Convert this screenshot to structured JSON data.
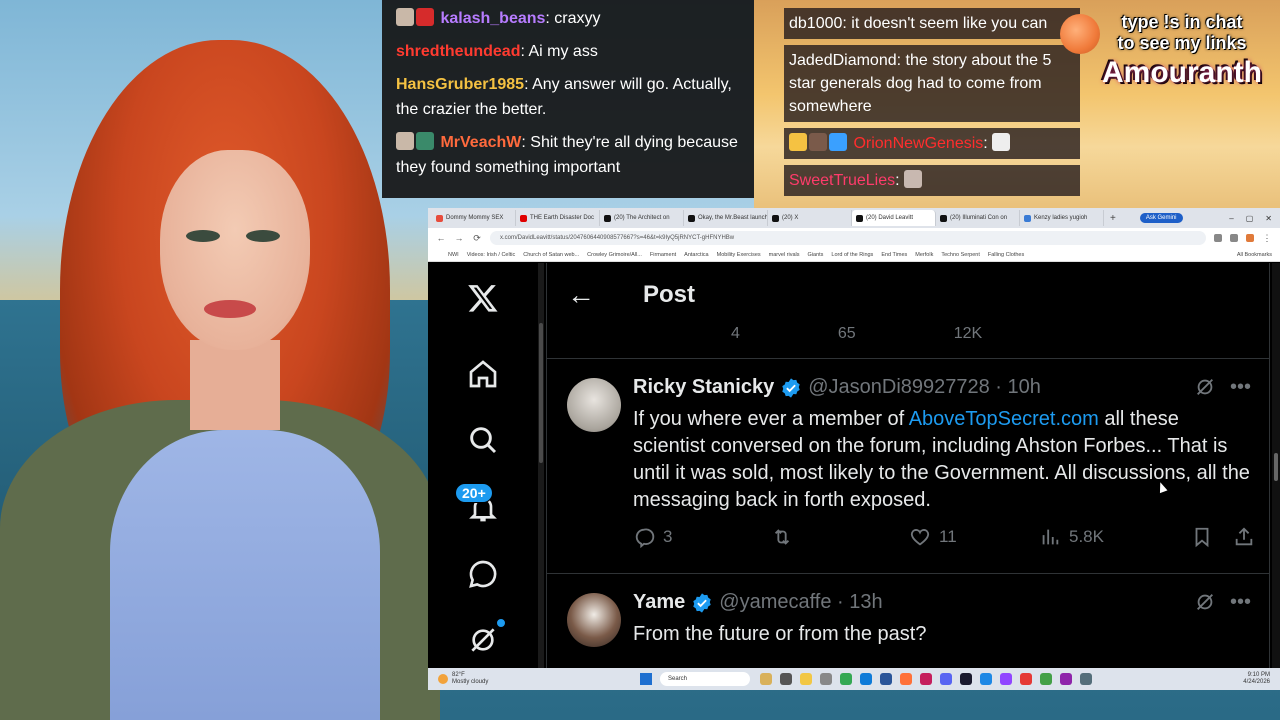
{
  "chat_left": [
    {
      "user": "kalash_beans",
      "color": "#b77cff",
      "text": ": craxyy",
      "emotes": [
        "skull",
        "umbrella"
      ]
    },
    {
      "user": "shredtheundead",
      "color": "#ff3b30",
      "text": ": Ai my ass",
      "emotes": []
    },
    {
      "user": "HansGruber1985",
      "color": "#f5c242",
      "text": ": Any answer will go. Actually, the crazier the better.",
      "emotes": []
    },
    {
      "user": "MrVeachW",
      "color": "#ff6a3d",
      "text": ": Shit they're all dying because they found something important",
      "emotes": [
        "skull",
        "fish"
      ]
    }
  ],
  "chat_right": [
    {
      "user": "db1000",
      "color": "#ffffff",
      "text": ": it doesn't seem like you can"
    },
    {
      "user": "JadedDiamond",
      "color": "#ffffff",
      "text": ": the story about the 5 star generals dog had to come from somewhere"
    },
    {
      "user": "OrionNewGenesis",
      "color": "#ff2d2d",
      "text": ": "
    },
    {
      "user": "SweetTrueLies",
      "color": "#ff3b6b",
      "text": ": "
    }
  ],
  "promo": {
    "line1": "type !s in chat",
    "line2": "to see my links",
    "name": "Amouranth"
  },
  "browser": {
    "tabs": [
      {
        "label": "Dommy Mommy SEX",
        "color": "#e74c3c",
        "active": false
      },
      {
        "label": "THE Earth Disaster Doc",
        "color": "#e00000",
        "active": false
      },
      {
        "label": "(20) The Architect on",
        "color": "#111111",
        "active": false
      },
      {
        "label": "Okay, the Mr.Beast launch",
        "color": "#111111",
        "active": false
      },
      {
        "label": "(20) X",
        "color": "#111111",
        "active": false
      },
      {
        "label": "(20) David Leavitt",
        "color": "#111111",
        "active": true
      },
      {
        "label": "(20) Illuminati Con on",
        "color": "#111111",
        "active": false
      },
      {
        "label": "Kenzy ladies yugioh",
        "color": "#3a7bd5",
        "active": false
      }
    ],
    "new_tab": "+",
    "ask_gemini": "Ask Gemini",
    "url": "x.com/DavidLeavitt/status/2047606440908577667?s=46&t=k9IyQ5jRNYCT-gHFNYHBw",
    "bookmarks": [
      "NWI",
      "Videos: Irish / Celtic",
      "Church of Satan web...",
      "Crowley Grimoire/All...",
      "Firmament",
      "Antarctica",
      "Mobility Exercises",
      "marvel rivals",
      "Giants",
      "Lord of the Rings",
      "End Times",
      "Merfolk",
      "Techno Serpent",
      "Falling Clothes"
    ],
    "all_bookmarks": "All Bookmarks"
  },
  "x": {
    "page_title": "Post",
    "prev_actions": [
      "",
      "4",
      "65",
      "12K"
    ],
    "notifications_badge": "20+",
    "tweets": [
      {
        "name": "Ricky Stanicky",
        "handle": "@JasonDi89927728 · 10h",
        "body_before": "If you where ever a member of ",
        "link": "AboveTopSecret.com",
        "body_after": " all these scientist conversed on the forum, including Ahston Forbes... That is until it was sold, most likely to the Government.  All discussions, all the messaging back in forth exposed.",
        "replies": "3",
        "reposts": "",
        "likes": "11",
        "views": "5.8K"
      },
      {
        "name": "Yame",
        "handle": "@yamecaffe · 13h",
        "body": "From the future or from the past?"
      }
    ]
  },
  "taskbar": {
    "weather_temp": "82°F",
    "weather_desc": "Mostly cloudy",
    "search": "Search",
    "time": "9:10 PM",
    "date": "4/24/2026"
  }
}
